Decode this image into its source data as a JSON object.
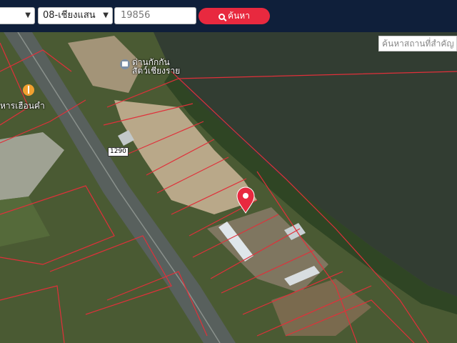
{
  "search": {
    "province_value": "",
    "district_value": "08-เชียงแสน",
    "parcel_number": "19856",
    "button_label": "ค้นหา",
    "place_placeholder": "ค้นหาสถานที่สำคัญ"
  },
  "map": {
    "poi_labels": [
      "ด่านกักกัน",
      "สัตว์เชียงราย",
      "หารเฮือนคำ"
    ],
    "road_number": "1290"
  },
  "colors": {
    "topbar": "#0f1f3a",
    "search_button": "#e8293f",
    "parcel_lines": "#e0303a",
    "marker": "#e8293f"
  }
}
